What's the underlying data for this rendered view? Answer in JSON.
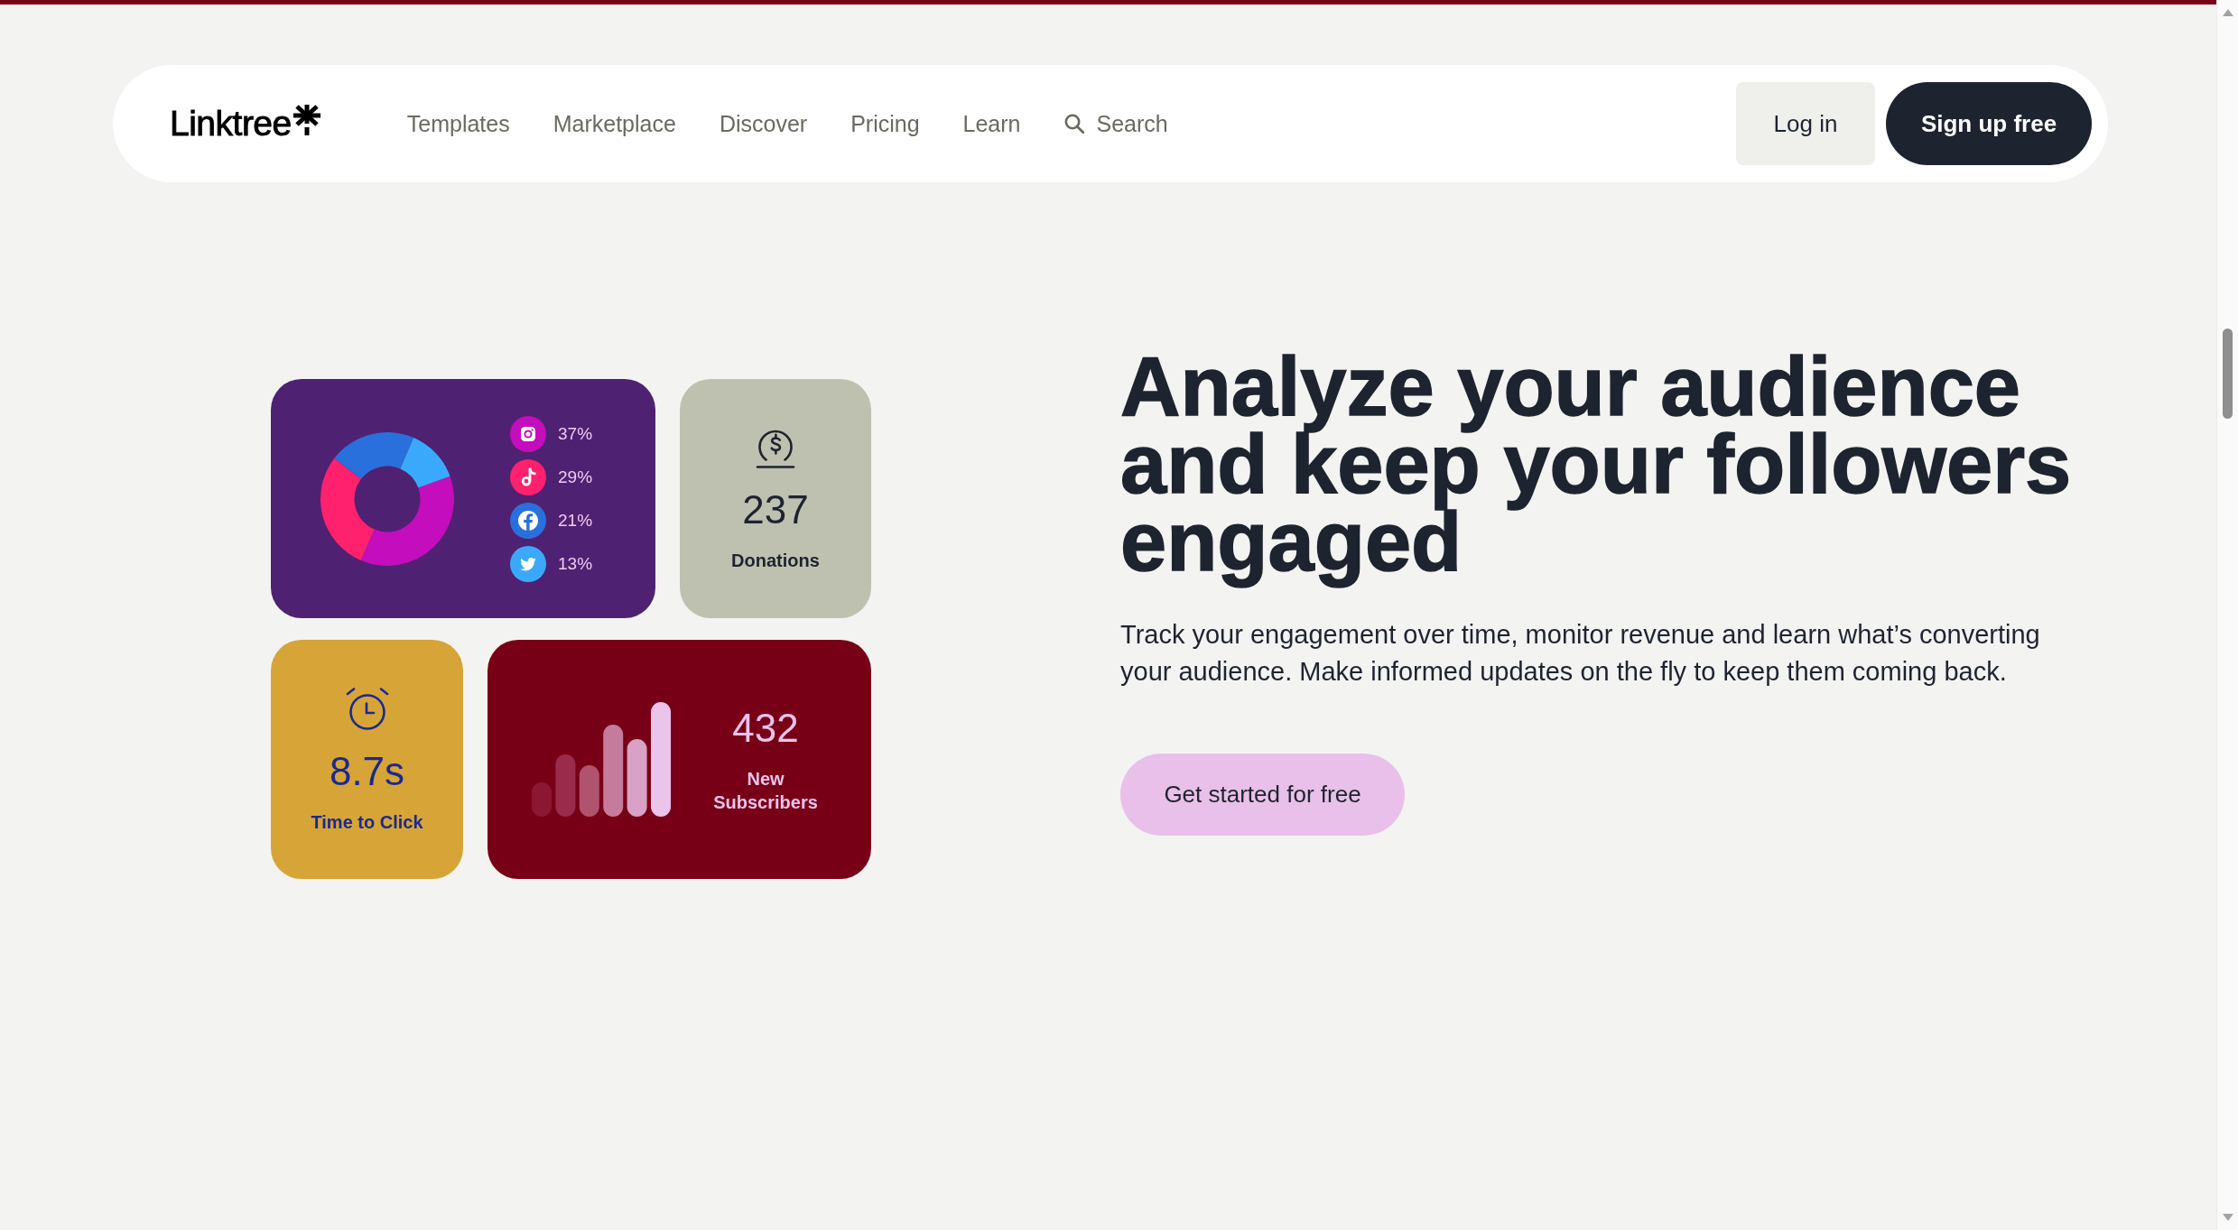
{
  "nav": {
    "logo": "Linktree",
    "links": [
      "Templates",
      "Marketplace",
      "Discover",
      "Pricing",
      "Learn"
    ],
    "search": "Search",
    "login": "Log in",
    "signup": "Sign up free"
  },
  "audience_card": {
    "chart_data": {
      "type": "donut",
      "values": [
        37,
        29,
        21,
        13
      ],
      "colors": [
        "#c40dbd",
        "#ff216e",
        "#2a70dc",
        "#3aa9fc"
      ]
    },
    "legend": [
      {
        "kind": "camera",
        "label": "37%"
      },
      {
        "kind": "note",
        "label": "29%"
      },
      {
        "kind": "letter",
        "label": "21%"
      },
      {
        "kind": "bird",
        "label": "13%"
      }
    ]
  },
  "donations_card": {
    "value": "237",
    "label": "Donations"
  },
  "time_card": {
    "value": "8.7s",
    "label": "Time to Click"
  },
  "subscribers_card": {
    "value": "432",
    "label": "New Subscribers"
  },
  "hero": {
    "heading": "Analyze your audience and keep your followers engaged",
    "text": "Track your engagement over time, monitor revenue and learn what’s converting your audience. Make informed updates on the fly to keep them coming back.",
    "button": "Get started for free"
  }
}
